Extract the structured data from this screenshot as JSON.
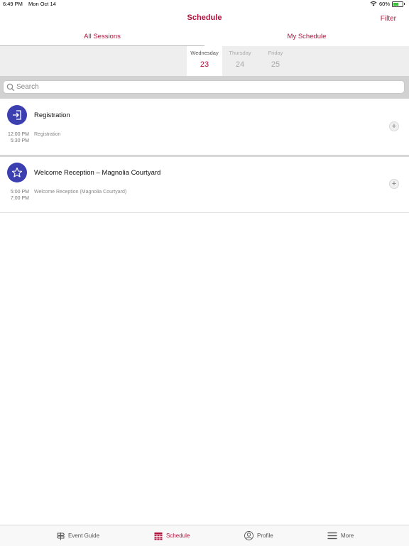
{
  "status_bar": {
    "time": "6:49 PM",
    "date": "Mon Oct 14",
    "battery": "60%",
    "battery_level": 0.6
  },
  "nav": {
    "title": "Schedule",
    "filter_label": "Filter"
  },
  "segments": {
    "all_sessions": "All Sessions",
    "my_schedule": "My Schedule"
  },
  "days": [
    {
      "name": "Wednesday",
      "num": "23"
    },
    {
      "name": "Thursday",
      "num": "24"
    },
    {
      "name": "Friday",
      "num": "25"
    }
  ],
  "search": {
    "placeholder": "Search"
  },
  "sessions": [
    {
      "title": "Registration",
      "start": "12:00 PM",
      "end": "5:30 PM",
      "subtitle": "Registration",
      "icon": "sign-in-icon",
      "add": "+"
    },
    {
      "title": "Welcome Reception – Magnolia Courtyard",
      "start": "5:00 PM",
      "end": "7:00 PM",
      "subtitle": "Welcome Reception (Magnolia Courtyard)",
      "icon": "star-icon",
      "add": "+"
    }
  ],
  "tabs": [
    {
      "label": "Event Guide",
      "icon": "signpost-icon"
    },
    {
      "label": "Schedule",
      "icon": "calendar-icon"
    },
    {
      "label": "Profile",
      "icon": "profile-icon"
    },
    {
      "label": "More",
      "icon": "menu-icon"
    }
  ],
  "colors": {
    "accent": "#b0123c",
    "avatar": "#3b3fb0",
    "battery": "#3cc13b"
  }
}
